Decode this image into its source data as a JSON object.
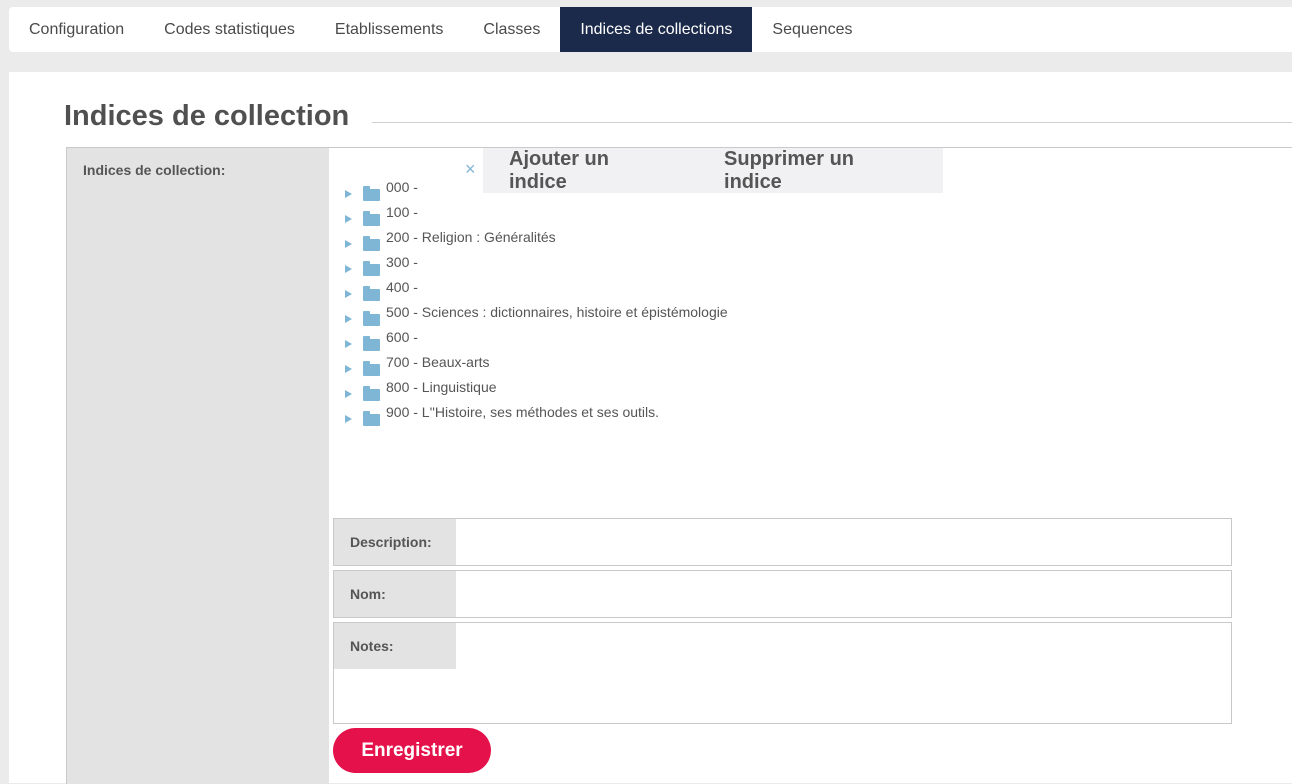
{
  "tabs": [
    {
      "label": "Configuration",
      "active": false
    },
    {
      "label": "Codes statistiques",
      "active": false
    },
    {
      "label": "Etablissements",
      "active": false
    },
    {
      "label": "Classes",
      "active": false
    },
    {
      "label": "Indices de collections",
      "active": true
    },
    {
      "label": "Sequences",
      "active": false
    }
  ],
  "page": {
    "title": "Indices de collection",
    "field_label": "Indices de collection:"
  },
  "actions": {
    "close_symbol": "×",
    "add_label": "Ajouter un indice",
    "delete_label": "Supprimer un indice"
  },
  "tree": {
    "items": [
      {
        "label": "000 -"
      },
      {
        "label": "100 -"
      },
      {
        "label": "200 - Religion : Généralités"
      },
      {
        "label": "300 -"
      },
      {
        "label": "400 -"
      },
      {
        "label": "500 - Sciences : dictionnaires, histoire et épistémologie"
      },
      {
        "label": "600 -"
      },
      {
        "label": "700 - Beaux-arts"
      },
      {
        "label": "800 - Linguistique"
      },
      {
        "label": "900 - L''Histoire, ses méthodes et ses outils."
      }
    ]
  },
  "form": {
    "description_label": "Description:",
    "description_value": "",
    "nom_label": "Nom:",
    "nom_value": "",
    "notes_label": "Notes:",
    "notes_value": "",
    "save_label": "Enregistrer"
  },
  "colors": {
    "active_tab": "#1b2a4a",
    "accent_icon": "#7fb5d5",
    "save_button": "#e5114a"
  },
  "icons": {
    "tree_toggle": "caret-right-icon",
    "tree_node": "folder-icon",
    "close": "close-icon"
  }
}
